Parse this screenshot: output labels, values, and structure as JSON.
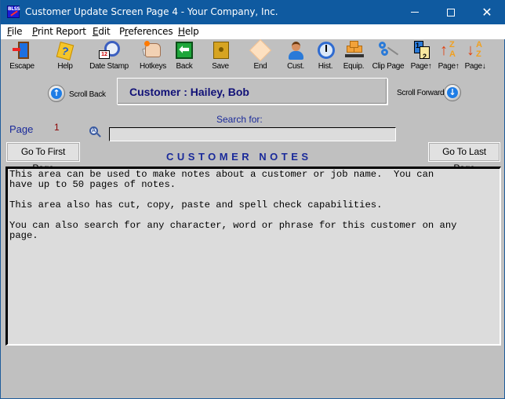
{
  "window": {
    "title": "Customer Update Screen Page 4 - Your Company, Inc.",
    "app_icon_text": "BLSS",
    "controls": {
      "minimize": "minimize",
      "maximize": "maximize",
      "close": "✕"
    }
  },
  "menu": [
    {
      "label": "File",
      "mnemonic": "F",
      "rest": "ile"
    },
    {
      "label": "Print Report",
      "mnemonic": "P",
      "rest": "rint Report"
    },
    {
      "label": "Edit",
      "mnemonic": "E",
      "rest": "dit"
    },
    {
      "label": "Preferences",
      "pre": "P",
      "mnemonic": "r",
      "rest": "eferences"
    },
    {
      "label": "Help",
      "mnemonic": "H",
      "rest": "elp"
    }
  ],
  "toolbar": [
    {
      "id": "escape",
      "label": "Escape",
      "icon": "door-exit-icon"
    },
    {
      "id": "help",
      "label": "Help",
      "icon": "help-book-icon"
    },
    {
      "id": "date-stamp",
      "label": "Date Stamp",
      "icon": "clock-calendar-icon"
    },
    {
      "id": "hotkeys",
      "label": "Hotkeys",
      "icon": "hand-keyboard-icon"
    },
    {
      "id": "back",
      "label": "Back",
      "icon": "back-arrow-icon",
      "glyph": "⬅"
    },
    {
      "id": "save",
      "label": "Save",
      "icon": "safe-icon"
    },
    {
      "id": "end",
      "label": "End",
      "icon": "eraser-icon"
    },
    {
      "id": "cust",
      "label": "Cust.",
      "icon": "person-icon"
    },
    {
      "id": "hist",
      "label": "Hist.",
      "icon": "history-clock-icon"
    },
    {
      "id": "equip",
      "label": "Equip.",
      "icon": "equipment-boxes-icon"
    },
    {
      "id": "clip-page",
      "label": "Clip Page",
      "icon": "scissors-icon"
    },
    {
      "id": "page-up-1",
      "label": "Page↑",
      "icon": "page-stack-icon",
      "n1": "1",
      "n2": "2"
    },
    {
      "id": "page-up-2",
      "label": "Page↑",
      "icon": "sort-up-icon",
      "glyph": "↑",
      "l1": "Z",
      "l2": "A"
    },
    {
      "id": "page-down",
      "label": "Page↓",
      "icon": "sort-down-icon",
      "glyph": "↓",
      "l1": "A",
      "l2": "Z"
    }
  ],
  "nav": {
    "scroll_back": "Scroll Back",
    "scroll_forward": "Scroll Forward",
    "up_glyph": "↑",
    "down_glyph": "↓",
    "customer_label": "Customer : Hailey, Bob"
  },
  "page": {
    "label": "Page",
    "number": "1"
  },
  "search": {
    "label": "Search for:",
    "value": "",
    "icon_text": "A"
  },
  "buttons": {
    "first": "Go To First Page",
    "last": "Go To Last Page"
  },
  "section_title": "CUSTOMER NOTES",
  "notes_text": "This area can be used to make notes about a customer or job name.  You can\nhave up to 50 pages of notes.\n\nThis area also has cut, copy, paste and spell check capabilities.\n\nYou can also search for any character, word or phrase for this customer on any\npage.",
  "colors": {
    "titlebar": "#0f5aa0",
    "label_blue": "#1a2a9a",
    "customer_text": "#111177",
    "page_number": "#8b0000",
    "panel": "#c0c0c0",
    "notes_bg": "#dcdcdc"
  }
}
